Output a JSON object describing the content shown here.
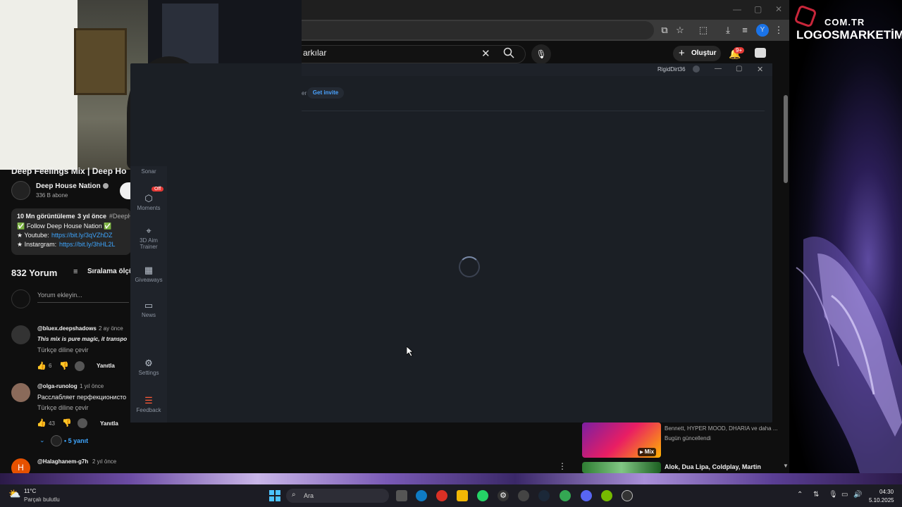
{
  "browser": {
    "search_text": "arkılar",
    "create_label": "Oluştur",
    "notification_badge": "9+"
  },
  "brand": {
    "top": "COM.TR",
    "name": "LOGOSMARKETİM"
  },
  "overlay": {
    "username": "RigidDirt36",
    "invite_prefix": "er",
    "invite_link": "Get invite",
    "nav": [
      {
        "label": "Sonar",
        "icon": "sonar-icon"
      },
      {
        "label": "Moments",
        "icon": "hexagon-icon",
        "badge": "Off"
      },
      {
        "label": "3D Aim Trainer",
        "icon": "crosshair-icon"
      },
      {
        "label": "Giveaways",
        "icon": "gift-icon"
      },
      {
        "label": "News",
        "icon": "book-icon"
      },
      {
        "label": "Settings",
        "icon": "gear-icon"
      },
      {
        "label": "Feedback",
        "icon": "feedback-icon"
      }
    ]
  },
  "video": {
    "title": "Deep Feelings Mix | Deep Ho",
    "channel": "Deep House Nation",
    "subscribers": "336 B abone",
    "views": "10 Mn görüntüleme",
    "age": "3 yıl önce",
    "hashtag": "#DeepH",
    "desc_line1": "✅ Follow Deep House Nation ✅",
    "desc_youtube_label": "★ Youtube:",
    "desc_youtube_link": "https://bit.ly/3qVZhDZ",
    "desc_instagram_label": "★ Instargram:",
    "desc_instagram_link": "https://bit.ly/3hHL2L"
  },
  "comments_header": {
    "count": "832 Yorum",
    "sort": "Sıralama ölçü",
    "placeholder": "Yorum ekleyin..."
  },
  "comments": [
    {
      "author": "@bluex.deepshadows",
      "age": "2 ay önce",
      "text": "This mix is pure magic, it transpo",
      "translate": "Türkçe diline çevir",
      "likes": "6",
      "reply": "Yanıtla"
    },
    {
      "author": "@olga-runolog",
      "age": "1 yıl önce",
      "text": "Расслабляет перфекционисто",
      "translate": "Türkçe diline çevir",
      "likes": "43",
      "reply": "Yanıtla",
      "replies": "• 5 yanıt"
    },
    {
      "author": "@Halaghanem-g7h",
      "age": "2 yıl önce",
      "avatar_letter": "H"
    }
  ],
  "sidebar_items": [
    {
      "artists": "Bennett, HYPER MOOD, DHARIA ve daha ...",
      "status": "Bugün güncellendi",
      "badge": "Mix"
    },
    {
      "artists": "Alok, Dua Lipa, Coldplay, Martin"
    }
  ],
  "taskbar": {
    "weather_temp": "11°C",
    "weather_desc": "Parçalı bulutlu",
    "search_label": "Ara",
    "time": "04:30",
    "date": "5.10.2025"
  },
  "colors": {
    "accent_blue": "#3ea6ff",
    "badge_red": "#e53935",
    "overlay_bg": "#1b1f25"
  }
}
